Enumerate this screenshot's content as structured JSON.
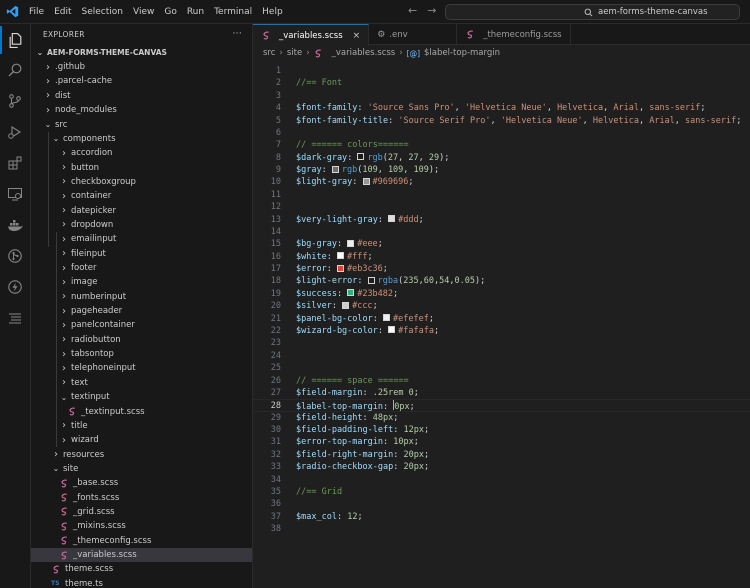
{
  "titlebar": {
    "menus": [
      "File",
      "Edit",
      "Selection",
      "View",
      "Go",
      "Run",
      "Terminal",
      "Help"
    ],
    "search_text": "aem-forms-theme-canvas"
  },
  "sidebar": {
    "header": "EXPLORER",
    "more": "···",
    "root": "AEM-FORMS-THEME-CANVAS",
    "tree": [
      {
        "label": ".github",
        "depth": 1,
        "kind": "folder",
        "open": false
      },
      {
        "label": ".parcel-cache",
        "depth": 1,
        "kind": "folder",
        "open": false
      },
      {
        "label": "dist",
        "depth": 1,
        "kind": "folder",
        "open": false
      },
      {
        "label": "node_modules",
        "depth": 1,
        "kind": "folder",
        "open": false
      },
      {
        "label": "src",
        "depth": 1,
        "kind": "folder",
        "open": true
      },
      {
        "label": "components",
        "depth": 2,
        "kind": "folder",
        "open": true
      },
      {
        "label": "accordion",
        "depth": 3,
        "kind": "folder",
        "open": false
      },
      {
        "label": "button",
        "depth": 3,
        "kind": "folder",
        "open": false
      },
      {
        "label": "checkboxgroup",
        "depth": 3,
        "kind": "folder",
        "open": false
      },
      {
        "label": "container",
        "depth": 3,
        "kind": "folder",
        "open": false
      },
      {
        "label": "datepicker",
        "depth": 3,
        "kind": "folder",
        "open": false
      },
      {
        "label": "dropdown",
        "depth": 3,
        "kind": "folder",
        "open": false
      },
      {
        "label": "emailinput",
        "depth": 3,
        "kind": "folder",
        "open": false
      },
      {
        "label": "fileinput",
        "depth": 3,
        "kind": "folder",
        "open": false
      },
      {
        "label": "footer",
        "depth": 3,
        "kind": "folder",
        "open": false
      },
      {
        "label": "image",
        "depth": 3,
        "kind": "folder",
        "open": false
      },
      {
        "label": "numberinput",
        "depth": 3,
        "kind": "folder",
        "open": false
      },
      {
        "label": "pageheader",
        "depth": 3,
        "kind": "folder",
        "open": false
      },
      {
        "label": "panelcontainer",
        "depth": 3,
        "kind": "folder",
        "open": false
      },
      {
        "label": "radiobutton",
        "depth": 3,
        "kind": "folder",
        "open": false
      },
      {
        "label": "tabsontop",
        "depth": 3,
        "kind": "folder",
        "open": false
      },
      {
        "label": "telephoneinput",
        "depth": 3,
        "kind": "folder",
        "open": false
      },
      {
        "label": "text",
        "depth": 3,
        "kind": "folder",
        "open": false
      },
      {
        "label": "textinput",
        "depth": 3,
        "kind": "folder",
        "open": true
      },
      {
        "label": "_textinput.scss",
        "depth": 4,
        "kind": "sass"
      },
      {
        "label": "title",
        "depth": 3,
        "kind": "folder",
        "open": false
      },
      {
        "label": "wizard",
        "depth": 3,
        "kind": "folder",
        "open": false
      },
      {
        "label": "resources",
        "depth": 2,
        "kind": "folder",
        "open": false
      },
      {
        "label": "site",
        "depth": 2,
        "kind": "folder",
        "open": true
      },
      {
        "label": "_base.scss",
        "depth": 3,
        "kind": "sass"
      },
      {
        "label": "_fonts.scss",
        "depth": 3,
        "kind": "sass"
      },
      {
        "label": "_grid.scss",
        "depth": 3,
        "kind": "sass"
      },
      {
        "label": "_mixins.scss",
        "depth": 3,
        "kind": "sass"
      },
      {
        "label": "_themeconfig.scss",
        "depth": 3,
        "kind": "sass"
      },
      {
        "label": "_variables.scss",
        "depth": 3,
        "kind": "sass",
        "selected": true
      },
      {
        "label": "theme.scss",
        "depth": 2,
        "kind": "sass"
      },
      {
        "label": "theme.ts",
        "depth": 2,
        "kind": "ts"
      }
    ]
  },
  "tabs": [
    {
      "label": "_variables.scss",
      "icon": "sass-icon",
      "active": true,
      "close": "×"
    },
    {
      "label": ".env",
      "icon": "gear-icon",
      "active": false
    },
    {
      "label": "_themeconfig.scss",
      "icon": "sass-icon",
      "active": false
    }
  ],
  "breadcrumbs": {
    "parts": [
      "src",
      "site",
      "_variables.scss",
      "$label-top-margin"
    ],
    "symbol_prefix": "[@]"
  },
  "editor": {
    "current_line": 28,
    "lines": [
      [],
      [
        [
          "t-com",
          "//== Font"
        ]
      ],
      [],
      [
        [
          "t-var",
          "$font-family"
        ],
        [
          "t-plain",
          ": "
        ],
        [
          "t-str",
          "'Source Sans Pro'"
        ],
        [
          "t-plain",
          ", "
        ],
        [
          "t-str",
          "'Helvetica Neue'"
        ],
        [
          "t-plain",
          ", "
        ],
        [
          "t-str",
          "Helvetica"
        ],
        [
          "t-plain",
          ", "
        ],
        [
          "t-str",
          "Arial"
        ],
        [
          "t-plain",
          ", "
        ],
        [
          "t-str",
          "sans-serif"
        ],
        [
          "t-plain",
          ";"
        ]
      ],
      [
        [
          "t-var",
          "$font-family-title"
        ],
        [
          "t-plain",
          ": "
        ],
        [
          "t-str",
          "'Source Serif Pro'"
        ],
        [
          "t-plain",
          ", "
        ],
        [
          "t-str",
          "'Helvetica Neue'"
        ],
        [
          "t-plain",
          ", "
        ],
        [
          "t-str",
          "Helvetica"
        ],
        [
          "t-plain",
          ", "
        ],
        [
          "t-str",
          "Arial"
        ],
        [
          "t-plain",
          ", "
        ],
        [
          "t-str",
          "sans-serif"
        ],
        [
          "t-plain",
          ";"
        ]
      ],
      [],
      [
        [
          "t-com",
          "// ====== colors======"
        ]
      ],
      [
        [
          "t-var",
          "$dark-gray"
        ],
        [
          "t-plain",
          ": "
        ],
        [
          "swatch",
          "#1b1b1d"
        ],
        [
          "t-rgb",
          "rgb"
        ],
        [
          "t-plain",
          "("
        ],
        [
          "t-num",
          "27"
        ],
        [
          "t-plain",
          ", "
        ],
        [
          "t-num",
          "27"
        ],
        [
          "t-plain",
          ", "
        ],
        [
          "t-num",
          "29"
        ],
        [
          "t-plain",
          ");"
        ]
      ],
      [
        [
          "t-var",
          "$gray"
        ],
        [
          "t-plain",
          ": "
        ],
        [
          "swatch",
          "#6d6d6d"
        ],
        [
          "t-rgb",
          "rgb"
        ],
        [
          "t-plain",
          "("
        ],
        [
          "t-num",
          "109"
        ],
        [
          "t-plain",
          ", "
        ],
        [
          "t-num",
          "109"
        ],
        [
          "t-plain",
          ", "
        ],
        [
          "t-num",
          "109"
        ],
        [
          "t-plain",
          ");"
        ]
      ],
      [
        [
          "t-var",
          "$light-gray"
        ],
        [
          "t-plain",
          ": "
        ],
        [
          "swatch",
          "#969696"
        ],
        [
          "t-str",
          "#969696"
        ],
        [
          "t-plain",
          ";"
        ]
      ],
      [],
      [],
      [
        [
          "t-var",
          "$very-light-gray"
        ],
        [
          "t-plain",
          ": "
        ],
        [
          "swatch",
          "#dddddd"
        ],
        [
          "t-str",
          "#ddd"
        ],
        [
          "t-plain",
          ";"
        ]
      ],
      [],
      [
        [
          "t-var",
          "$bg-gray"
        ],
        [
          "t-plain",
          ": "
        ],
        [
          "swatch",
          "#eeeeee"
        ],
        [
          "t-str",
          "#eee"
        ],
        [
          "t-plain",
          ";"
        ]
      ],
      [
        [
          "t-var",
          "$white"
        ],
        [
          "t-plain",
          ": "
        ],
        [
          "swatch",
          "#ffffff"
        ],
        [
          "t-str",
          "#fff"
        ],
        [
          "t-plain",
          ";"
        ]
      ],
      [
        [
          "t-var",
          "$error"
        ],
        [
          "t-plain",
          ": "
        ],
        [
          "swatch",
          "#eb3c36"
        ],
        [
          "t-str",
          "#eb3c36"
        ],
        [
          "t-plain",
          ";"
        ]
      ],
      [
        [
          "t-var",
          "$light-error"
        ],
        [
          "t-plain",
          ": "
        ],
        [
          "swatch",
          "#1f1f1f"
        ],
        [
          "t-rgb",
          "rgba"
        ],
        [
          "t-plain",
          "("
        ],
        [
          "t-num",
          "235"
        ],
        [
          "t-plain",
          ","
        ],
        [
          "t-num",
          "60"
        ],
        [
          "t-plain",
          ","
        ],
        [
          "t-num",
          "54"
        ],
        [
          "t-plain",
          ","
        ],
        [
          "t-num",
          "0.05"
        ],
        [
          "t-plain",
          ");"
        ]
      ],
      [
        [
          "t-var",
          "$success"
        ],
        [
          "t-plain",
          ": "
        ],
        [
          "swatch",
          "#23b482"
        ],
        [
          "t-str",
          "#23b482"
        ],
        [
          "t-plain",
          ";"
        ]
      ],
      [
        [
          "t-var",
          "$silver"
        ],
        [
          "t-plain",
          ": "
        ],
        [
          "swatch",
          "#cccccc"
        ],
        [
          "t-str",
          "#ccc"
        ],
        [
          "t-plain",
          ";"
        ]
      ],
      [
        [
          "t-var",
          "$panel-bg-color"
        ],
        [
          "t-plain",
          ": "
        ],
        [
          "swatch",
          "#efefef"
        ],
        [
          "t-str",
          "#efefef"
        ],
        [
          "t-plain",
          ";"
        ]
      ],
      [
        [
          "t-var",
          "$wizard-bg-color"
        ],
        [
          "t-plain",
          ": "
        ],
        [
          "swatch",
          "#fafafa"
        ],
        [
          "t-str",
          "#fafafa"
        ],
        [
          "t-plain",
          ";"
        ]
      ],
      [],
      [],
      [],
      [
        [
          "t-com",
          "// ====== space ======"
        ]
      ],
      [
        [
          "t-var",
          "$field-margin"
        ],
        [
          "t-plain",
          ": "
        ],
        [
          "t-num",
          ".25rem"
        ],
        [
          "t-plain",
          " "
        ],
        [
          "t-num",
          "0"
        ],
        [
          "t-plain",
          ";"
        ]
      ],
      [
        [
          "t-var",
          "$label-top-margin"
        ],
        [
          "t-plain",
          ": "
        ],
        [
          "cursor",
          ""
        ],
        [
          "t-num",
          "0px"
        ],
        [
          "t-plain",
          ";"
        ]
      ],
      [
        [
          "t-var",
          "$field-height"
        ],
        [
          "t-plain",
          ": "
        ],
        [
          "t-num",
          "48px"
        ],
        [
          "t-plain",
          ";"
        ]
      ],
      [
        [
          "t-var",
          "$field-padding-left"
        ],
        [
          "t-plain",
          ": "
        ],
        [
          "t-num",
          "12px"
        ],
        [
          "t-plain",
          ";"
        ]
      ],
      [
        [
          "t-var",
          "$error-top-margin"
        ],
        [
          "t-plain",
          ": "
        ],
        [
          "t-num",
          "10px"
        ],
        [
          "t-plain",
          ";"
        ]
      ],
      [
        [
          "t-var",
          "$field-right-margin"
        ],
        [
          "t-plain",
          ": "
        ],
        [
          "t-num",
          "20px"
        ],
        [
          "t-plain",
          ";"
        ]
      ],
      [
        [
          "t-var",
          "$radio-checkbox-gap"
        ],
        [
          "t-plain",
          ": "
        ],
        [
          "t-num",
          "20px"
        ],
        [
          "t-plain",
          ";"
        ]
      ],
      [],
      [
        [
          "t-com",
          "//== Grid"
        ]
      ],
      [],
      [
        [
          "t-var",
          "$max_col"
        ],
        [
          "t-plain",
          ": "
        ],
        [
          "t-num",
          "12"
        ],
        [
          "t-plain",
          ";"
        ]
      ],
      []
    ]
  },
  "colors": {
    "accent": "#0078d4",
    "sass": "#cd6799",
    "ts": "#3178c6",
    "background": "#1f1f1f",
    "chrome": "#181818"
  }
}
